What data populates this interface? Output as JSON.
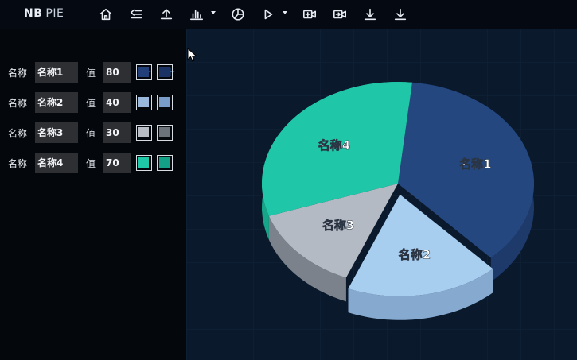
{
  "app": {
    "brand_bold": "NB",
    "brand_light": "PIE"
  },
  "toolbar": {
    "icons": [
      "home-icon",
      "list-indent-icon",
      "upload-icon",
      "bar-chart-icon",
      "pie-chart-icon",
      "play-icon",
      "video-add-icon",
      "video-export-icon",
      "download-icon",
      "download-alt-icon"
    ]
  },
  "editor": {
    "minus": "−",
    "plus": "+",
    "name_label": "名称",
    "value_label": "值",
    "items": [
      {
        "name": "名称1",
        "value": "80",
        "color_top": "#233f7a",
        "color_side": "#1a3264"
      },
      {
        "name": "名称2",
        "value": "40",
        "color_top": "#9ab8dc",
        "color_side": "#7a9cc8"
      },
      {
        "name": "名称3",
        "value": "30",
        "color_top": "#b9bec6",
        "color_side": "#6d737b"
      },
      {
        "name": "名称4",
        "value": "70",
        "color_top": "#1fc9a8",
        "color_side": "#13a287"
      }
    ]
  },
  "chart_data": {
    "type": "pie",
    "style": "3d",
    "categories": [
      "名称1",
      "名称2",
      "名称3",
      "名称4"
    ],
    "values": [
      80,
      40,
      30,
      70
    ],
    "colors": [
      "#24477f",
      "#a7cdef",
      "#b4bac3",
      "#1fc7a8"
    ],
    "side_colors": [
      "#1d3a6b",
      "#85a9cf",
      "#7b828b",
      "#17a58a"
    ]
  }
}
